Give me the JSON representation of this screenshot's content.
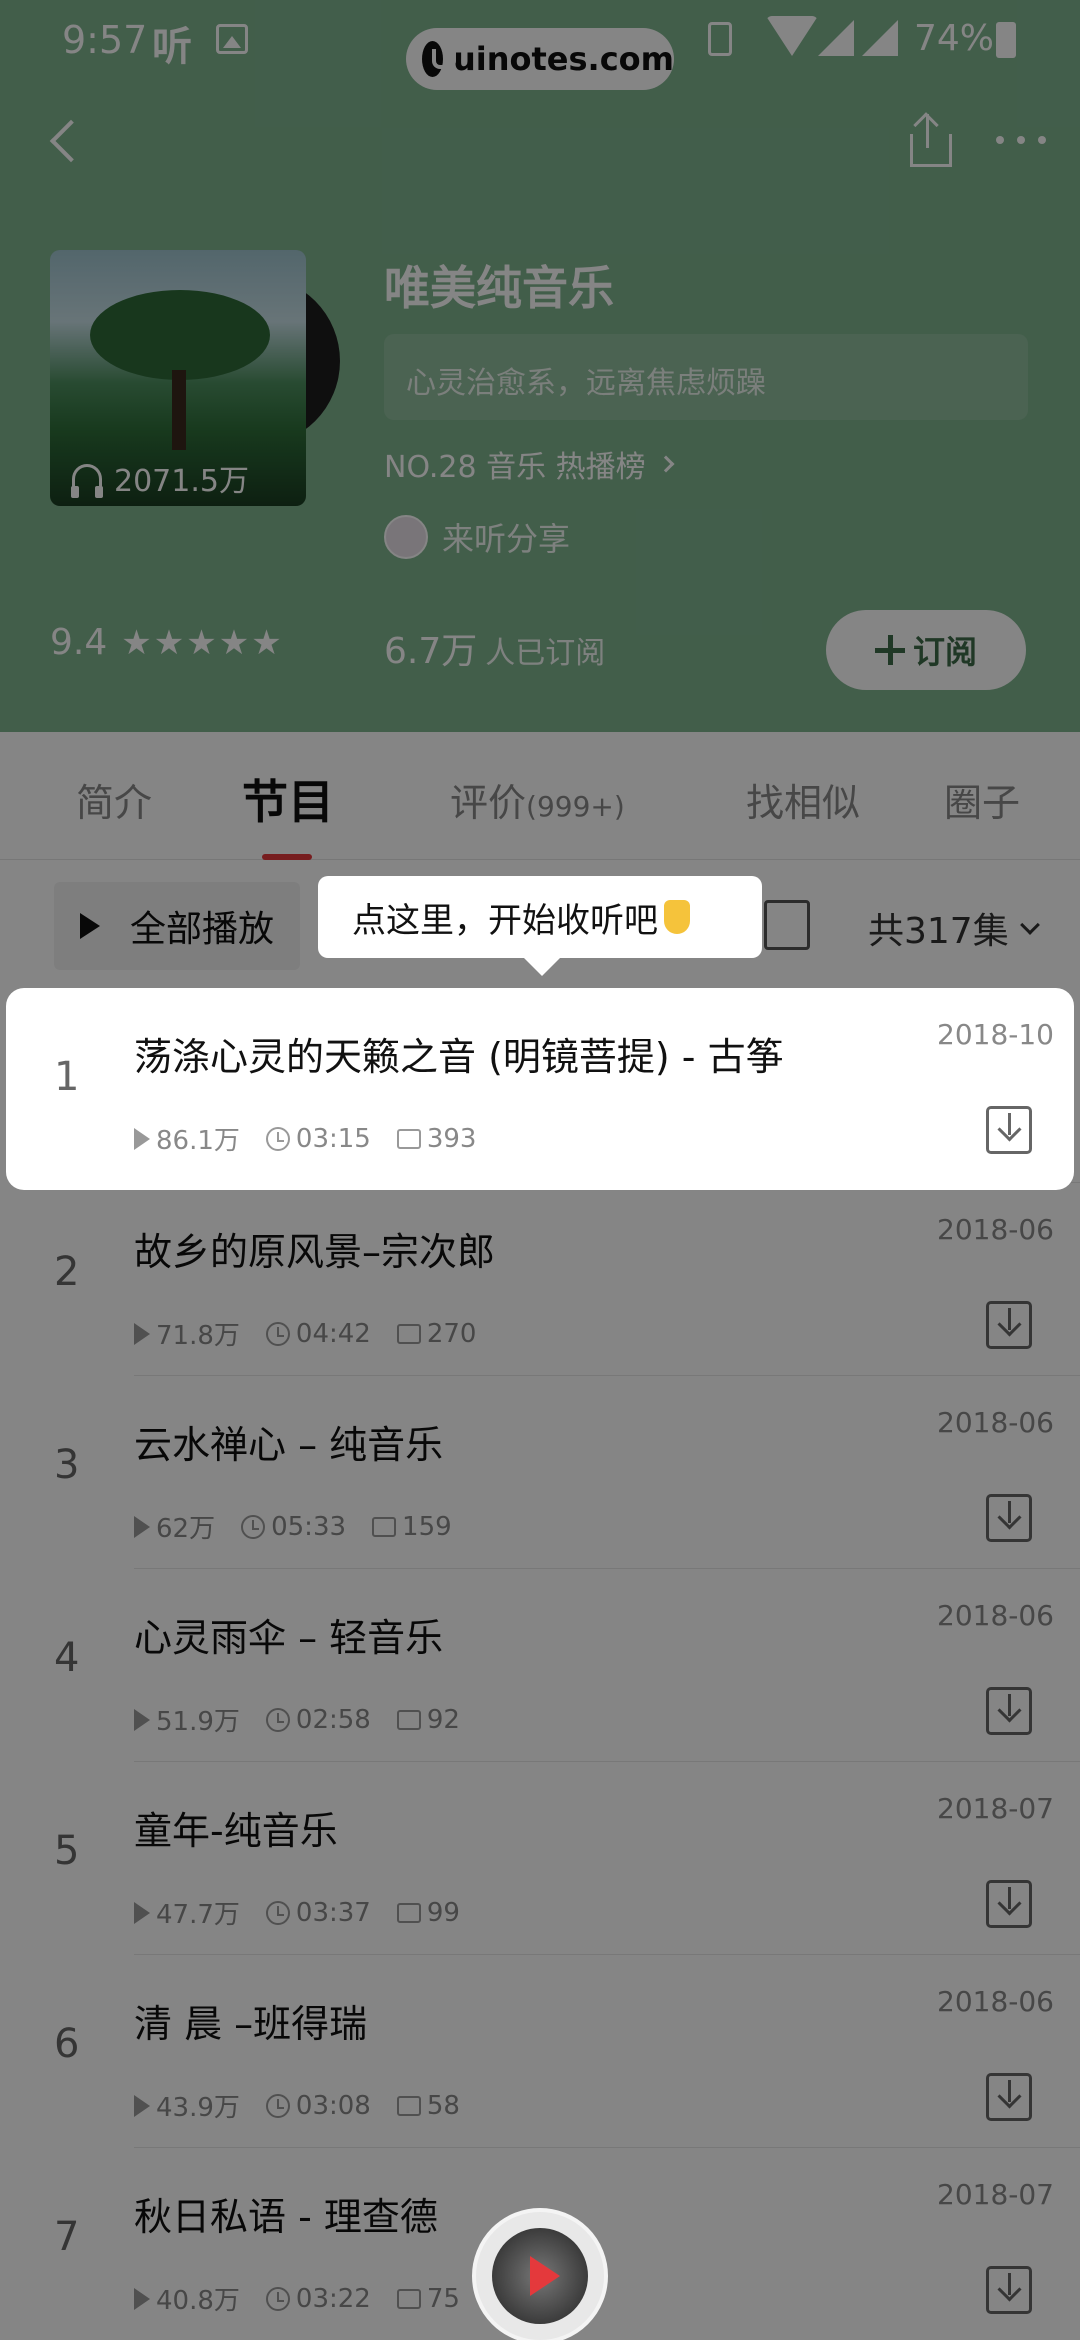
{
  "status_bar": {
    "time": "9:57",
    "app_glyph": "听",
    "battery": "74%",
    "watermark": "uinotes.com"
  },
  "album": {
    "play_count": "2071.5万",
    "title": "唯美纯音乐",
    "subtitle": "心灵治愈系，远离焦虑烦躁",
    "rank": "NO.28 音乐 热播榜",
    "author": "来听分享",
    "rating": "9.4",
    "stars": "★★★★★",
    "subscribers": "6.7万",
    "subscribers_label": "人已订阅",
    "subscribe_label": "订阅"
  },
  "tabs": [
    {
      "label": "简介"
    },
    {
      "label": "节目",
      "active": true
    },
    {
      "label": "评价",
      "sub": "(999+)"
    },
    {
      "label": "找相似"
    },
    {
      "label": "圈子"
    }
  ],
  "toolbar": {
    "play_all": "全部播放",
    "episode_count": "共317集"
  },
  "tooltip": "点这里，开始收听吧",
  "episodes": [
    {
      "index": "1",
      "title": "荡涤心灵的天籁之音 (明镜菩提) - 古筝",
      "date": "2018-10",
      "plays": "86.1万",
      "duration": "03:15",
      "comments": "393"
    },
    {
      "index": "2",
      "title": "故乡的原风景–宗次郎",
      "date": "2018-06",
      "plays": "71.8万",
      "duration": "04:42",
      "comments": "270"
    },
    {
      "index": "3",
      "title": "云水禅心 – 纯音乐",
      "date": "2018-06",
      "plays": "62万",
      "duration": "05:33",
      "comments": "159"
    },
    {
      "index": "4",
      "title": "心灵雨伞 – 轻音乐",
      "date": "2018-06",
      "plays": "51.9万",
      "duration": "02:58",
      "comments": "92"
    },
    {
      "index": "5",
      "title": "童年-纯音乐",
      "date": "2018-07",
      "plays": "47.7万",
      "duration": "03:37",
      "comments": "99"
    },
    {
      "index": "6",
      "title": "清 晨 –班得瑞",
      "date": "2018-06",
      "plays": "43.9万",
      "duration": "03:08",
      "comments": "58"
    },
    {
      "index": "7",
      "title": "秋日私语 - 理查德",
      "date": "2018-07",
      "plays": "40.8万",
      "duration": "03:22",
      "comments": "75"
    }
  ],
  "colors": {
    "header_bg": "#7fb48f",
    "accent_red": "#e4393c",
    "subscribe_text": "#3f6b49"
  }
}
